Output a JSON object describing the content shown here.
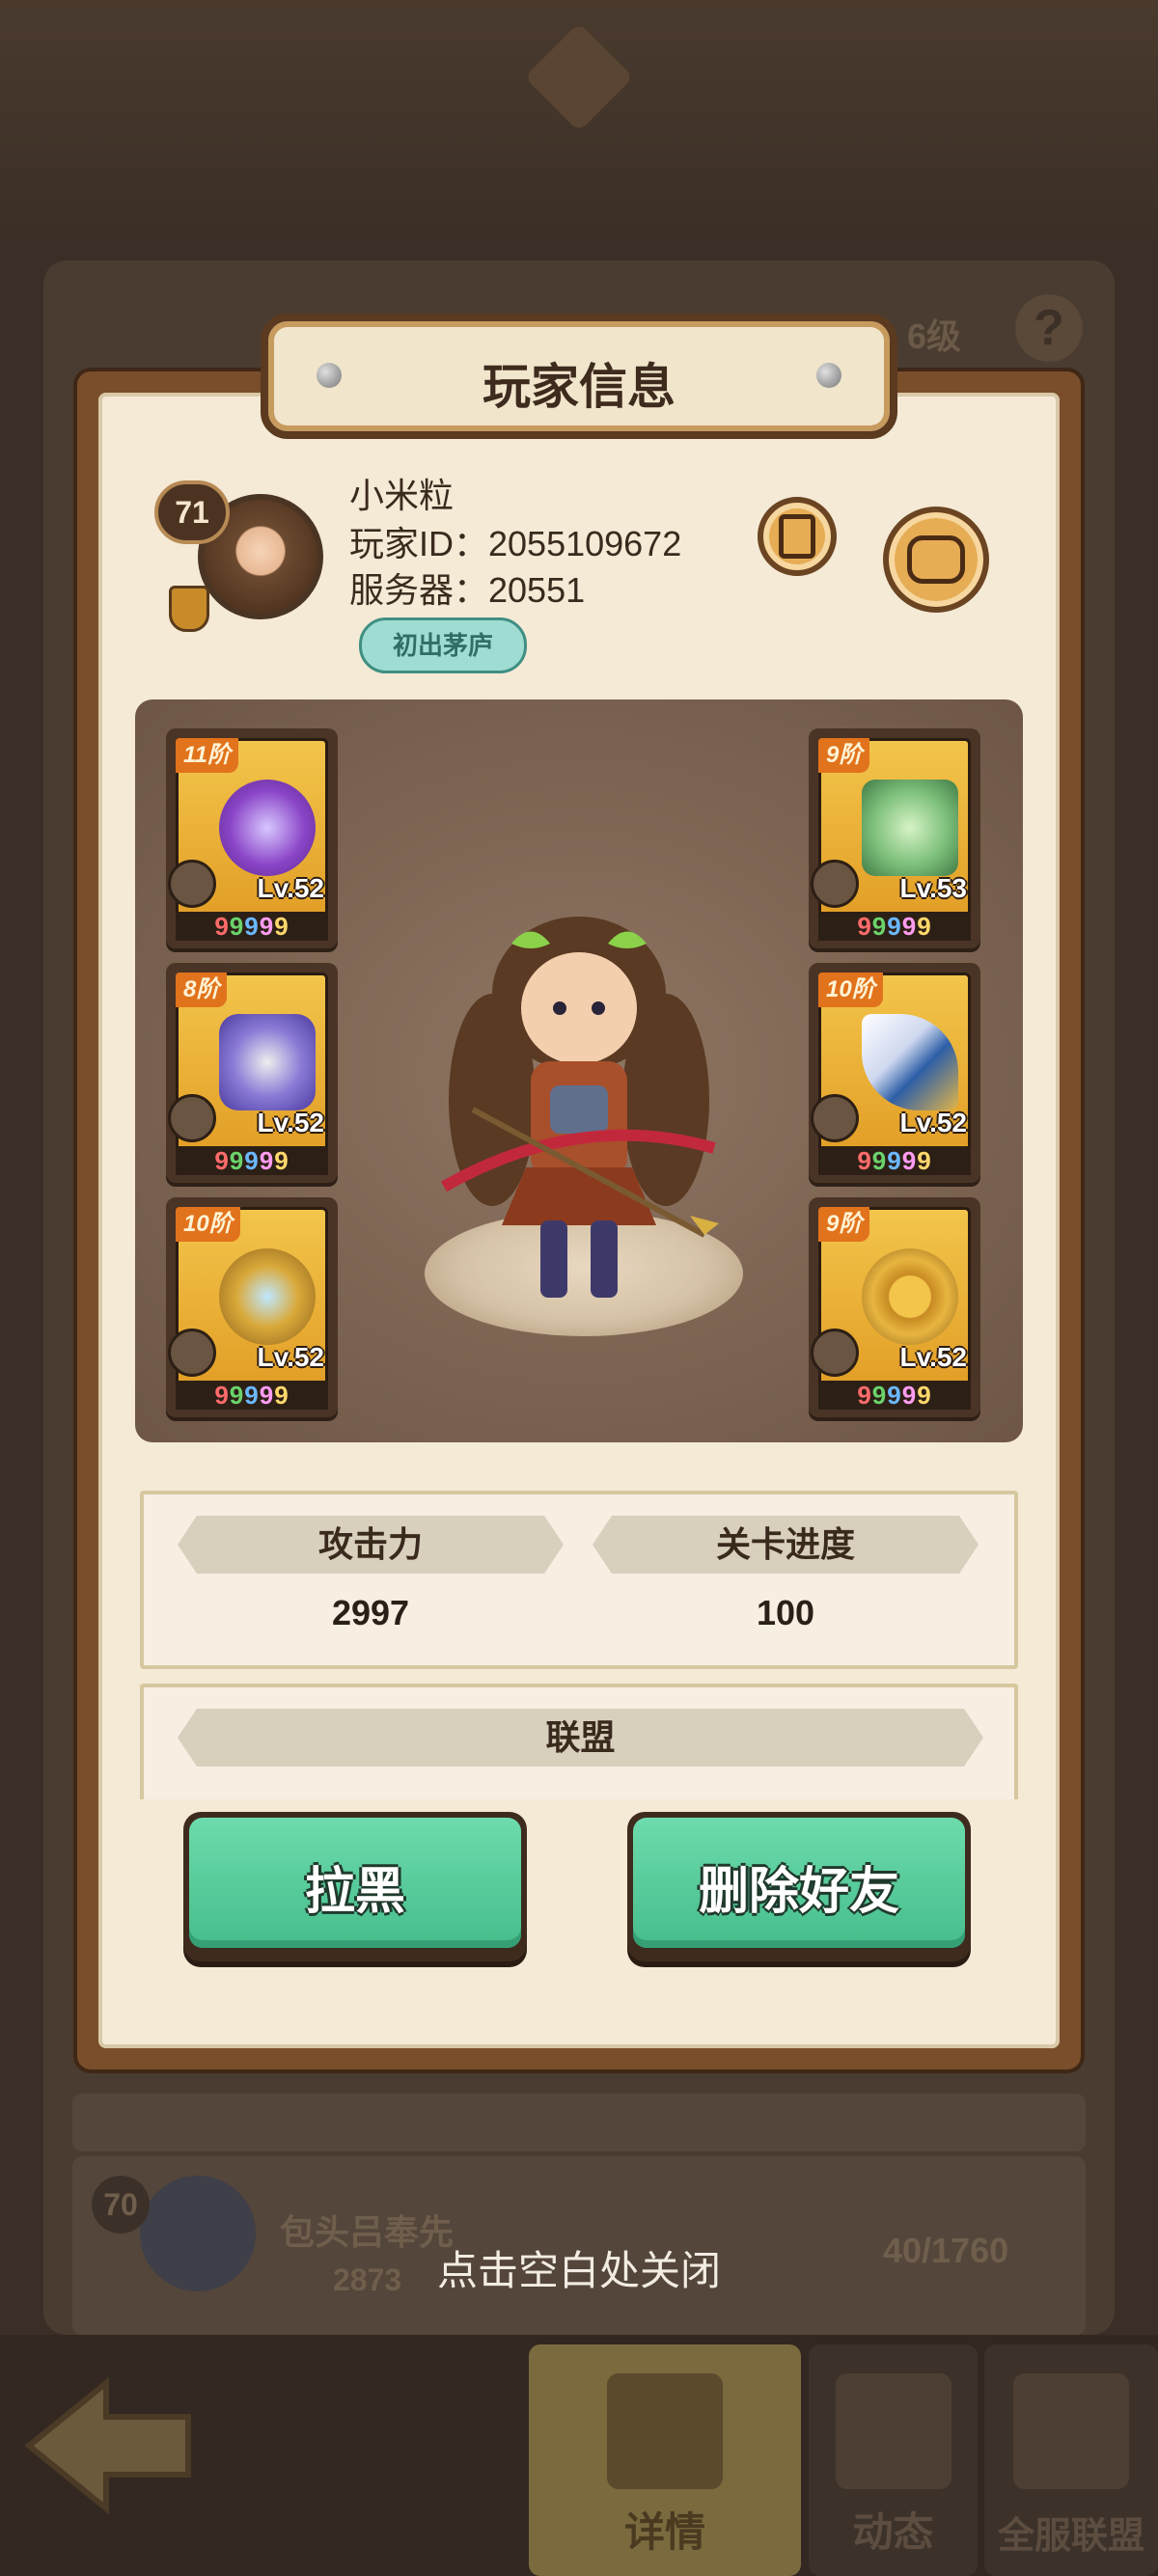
{
  "background": {
    "level_text": "6级",
    "help_icon": "question-icon",
    "row": {
      "level": "70",
      "name": "包头吕奉先",
      "number": "2873",
      "fraction": "40/1760"
    },
    "close_hint": "点击空白处关闭",
    "nav": {
      "back_icon": "back-arrow-icon",
      "tab_details": "详情",
      "tab_feed": "动态",
      "tab_alliance": "全服联盟"
    }
  },
  "modal": {
    "title": "玩家信息",
    "player": {
      "level": "71",
      "name": "小米粒",
      "id_line": "玩家ID：2055109672",
      "server_line": "服务器：20551",
      "title_badge": "初出茅庐"
    },
    "equipment": {
      "left": [
        {
          "tier": "11阶",
          "level": "Lv.52",
          "gems": "99999"
        },
        {
          "tier": "8阶",
          "level": "Lv.52",
          "gems": "99999"
        },
        {
          "tier": "10阶",
          "level": "Lv.52",
          "gems": "99999"
        }
      ],
      "right": [
        {
          "tier": "9阶",
          "level": "Lv.53",
          "gems": "99999"
        },
        {
          "tier": "10阶",
          "level": "Lv.52",
          "gems": "99999"
        },
        {
          "tier": "9阶",
          "level": "Lv.52",
          "gems": "99999"
        }
      ]
    },
    "stats": {
      "attack_label": "攻击力",
      "attack_value": "2997",
      "progress_label": "关卡进度",
      "progress_value": "100"
    },
    "alliance_label": "联盟",
    "buttons": {
      "block": "拉黑",
      "delete_friend": "删除好友"
    }
  },
  "colors": {
    "accent_green": "#46bd8c",
    "tier_orange": "#e1731c",
    "card_gold": "#f3c54b"
  }
}
